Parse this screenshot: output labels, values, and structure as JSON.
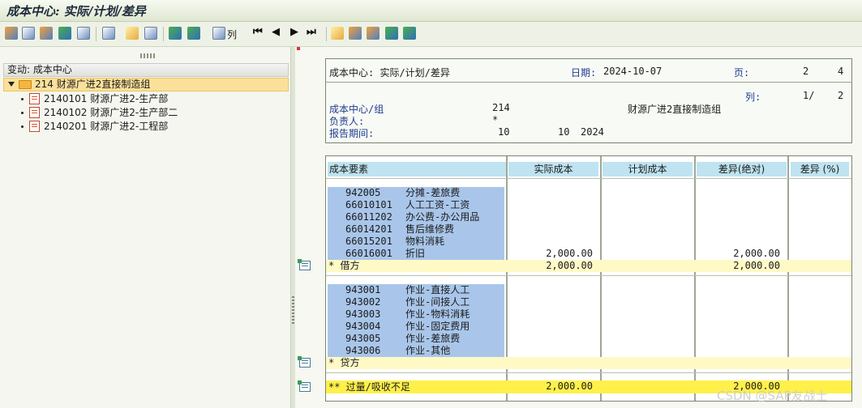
{
  "title": "成本中心: 实际/计划/差异",
  "toolbar": {
    "columns_label": "列"
  },
  "tree": {
    "header": "变动:  成本中心",
    "root_label": "214 财源广进2直接制造组",
    "items": [
      {
        "label": "2140101 财源广进2-生产部"
      },
      {
        "label": "2140102 财源广进2-生产部二"
      },
      {
        "label": "2140201 财源广进2-工程部"
      }
    ]
  },
  "report": {
    "title": "成本中心: 实际/计划/差异",
    "date_label": "日期:",
    "date_value": "2024-10-07",
    "page_label": "页:",
    "page_current": "2",
    "page_total": "4",
    "col_label": "列:",
    "col_current": "1/",
    "col_total": "2",
    "cc_label": "成本中心/组",
    "cc_value": "214",
    "cc_name": "财源广进2直接制造组",
    "owner_label": "负责人:",
    "owner_value": "*",
    "period_label": "报告期间:",
    "period_from": "10",
    "period_to": "10",
    "period_year": "2024"
  },
  "table": {
    "columns": [
      "成本要素",
      "实际成本",
      "计划成本",
      "差异(绝对)",
      "差异 (%)"
    ],
    "debit_rows": [
      {
        "code": "942005",
        "name": "分摊-差旅费",
        "actual": "",
        "variance": ""
      },
      {
        "code": "66010101",
        "name": "人工工资-工资",
        "actual": "",
        "variance": ""
      },
      {
        "code": "66011202",
        "name": "办公费-办公用品",
        "actual": "",
        "variance": ""
      },
      {
        "code": "66014201",
        "name": "售后维修费",
        "actual": "",
        "variance": ""
      },
      {
        "code": "66015201",
        "name": "物料消耗",
        "actual": "",
        "variance": ""
      },
      {
        "code": "66016001",
        "name": "折旧",
        "actual": "2,000.00",
        "variance": "2,000.00"
      }
    ],
    "debit_subtotal": {
      "label": "*  借方",
      "actual": "2,000.00",
      "variance": "2,000.00"
    },
    "credit_rows": [
      {
        "code": "943001",
        "name": "作业-直接人工"
      },
      {
        "code": "943002",
        "name": "作业-间接人工"
      },
      {
        "code": "943003",
        "name": "作业-物料消耗"
      },
      {
        "code": "943004",
        "name": "作业-固定费用"
      },
      {
        "code": "943005",
        "name": "作业-差旅费"
      },
      {
        "code": "943006",
        "name": "作业-其他"
      }
    ],
    "credit_subtotal": {
      "label": "*  贷方"
    },
    "total": {
      "label": "** 过量/吸收不足",
      "actual": "2,000.00",
      "variance": "2,000.00"
    }
  },
  "watermark": "CSDN @SAP友战士"
}
